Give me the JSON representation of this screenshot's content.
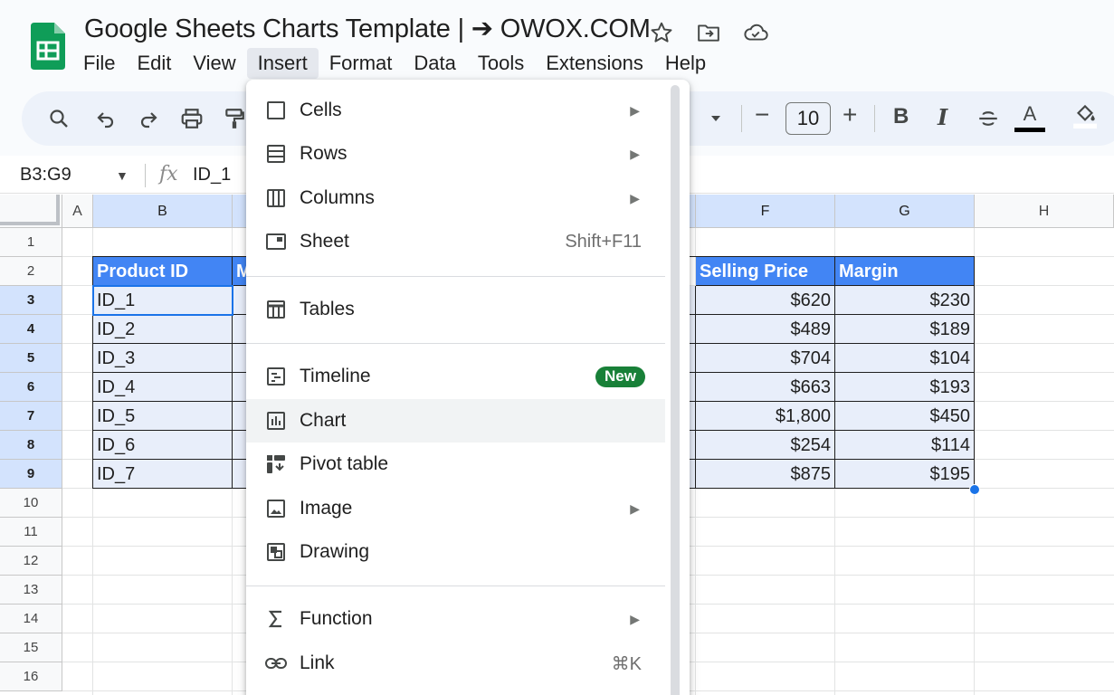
{
  "app": {
    "title": "Google Sheets Charts Template | ➔ OWOX.COM",
    "icons": [
      "star-icon",
      "move-to-folder-icon",
      "cloud-saved-icon"
    ]
  },
  "menubar": {
    "items": [
      "File",
      "Edit",
      "View",
      "Insert",
      "Format",
      "Data",
      "Tools",
      "Extensions",
      "Help"
    ],
    "active": "Insert"
  },
  "toolbar": {
    "icons": [
      "search-icon",
      "undo-icon",
      "redo-icon",
      "print-icon",
      "paint-format-icon",
      "font-size-dropdown-icon",
      "decrease-font-icon",
      "increase-font-icon",
      "bold-icon",
      "italic-icon",
      "strikethrough-icon",
      "text-color-icon",
      "fill-color-icon"
    ],
    "font_size": "10",
    "minus": "−",
    "plus": "+",
    "bold": "B",
    "italic": "I",
    "text_color_letter": "A"
  },
  "formula_bar": {
    "name_box": "B3:G9",
    "fx": "fx",
    "value": "ID_1"
  },
  "grid": {
    "columns": [
      "A",
      "B",
      "",
      "",
      "",
      "F",
      "G",
      "H"
    ],
    "rows": [
      "1",
      "2",
      "3",
      "4",
      "5",
      "6",
      "7",
      "8",
      "9",
      "10",
      "11",
      "12",
      "13",
      "14",
      "15",
      "16"
    ],
    "partial_header_c": "M",
    "partial_body_e": ")",
    "b_header": "Product ID",
    "f_header": "Selling Price",
    "g_header": "Margin",
    "product_ids": [
      "ID_1",
      "ID_2",
      "ID_3",
      "ID_4",
      "ID_5",
      "ID_6",
      "ID_7"
    ],
    "selling_prices": [
      "$620",
      "$489",
      "$704",
      "$663",
      "$1,800",
      "$254",
      "$875"
    ],
    "margins": [
      "$230",
      "$189",
      "$104",
      "$193",
      "$450",
      "$114",
      "$195"
    ]
  },
  "insert_menu": {
    "cells": "Cells",
    "rows": "Rows",
    "columns": "Columns",
    "sheet": "Sheet",
    "sheet_shortcut": "Shift+F11",
    "tables": "Tables",
    "timeline": "Timeline",
    "timeline_badge": "New",
    "chart": "Chart",
    "pivot_table": "Pivot table",
    "image": "Image",
    "drawing": "Drawing",
    "function": "Function",
    "link": "Link",
    "link_shortcut": "⌘K",
    "submenu_arrow": "▶",
    "hovered": "Chart"
  },
  "colors": {
    "sheets_green": "#0f9d58",
    "header_fill": "#4285f4",
    "selection_fill": "#e8eefa",
    "selection_blue": "#1a73e8",
    "badge_green": "#188038"
  }
}
